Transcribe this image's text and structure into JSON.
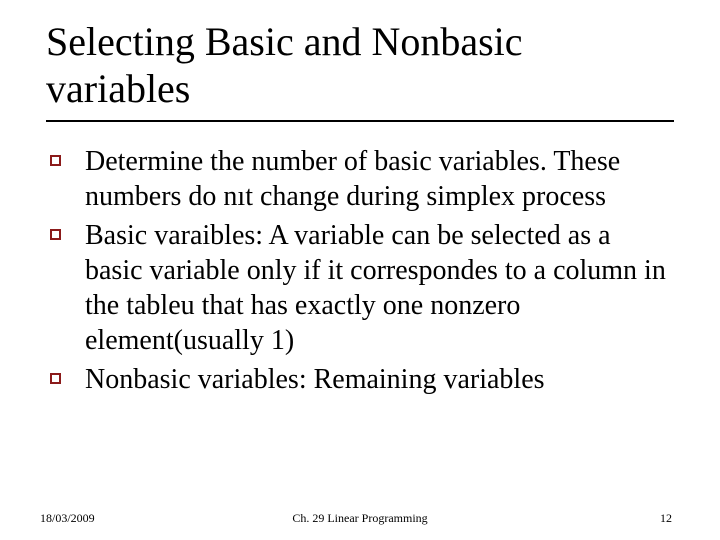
{
  "title": "Selecting Basic and Nonbasic variables",
  "bullets": [
    "Determine the number of basic variables. These numbers do nıt change during simplex process",
    "Basic varaibles: A variable can be selected as a basic variable only if it correspondes to a column in the tableu that has exactly one nonzero element(usually 1)",
    "Nonbasic variables: Remaining variables"
  ],
  "footer": {
    "date": "18/03/2009",
    "chapter": "Ch. 29 Linear Programming",
    "page": "12"
  }
}
